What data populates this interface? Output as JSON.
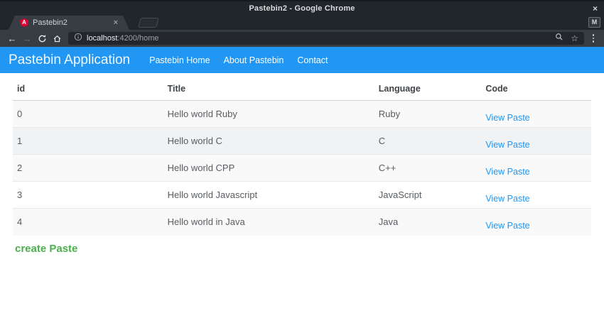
{
  "window": {
    "title": "Pastebin2 - Google Chrome",
    "close_glyph": "×"
  },
  "tabbar": {
    "favicon_letter": "A",
    "tab_title": "Pastebin2",
    "tab_close_glyph": "×",
    "profile_label": "M"
  },
  "toolbar": {
    "back_glyph": "←",
    "forward_glyph": "→",
    "url_host": "localhost",
    "url_rest": ":4200/home",
    "star_glyph": "☆"
  },
  "navbar": {
    "brand": "Pastebin Application",
    "links": [
      "Pastebin Home",
      "About Pastebin",
      "Contact"
    ]
  },
  "table": {
    "headers": [
      "id",
      "Title",
      "Language",
      "Code"
    ],
    "rows": [
      {
        "id": "0",
        "title": "Hello world Ruby",
        "language": "Ruby",
        "code_link": "View Paste"
      },
      {
        "id": "1",
        "title": "Hello world C",
        "language": "C",
        "code_link": "View Paste"
      },
      {
        "id": "2",
        "title": "Hello world CPP",
        "language": "C++",
        "code_link": "View Paste"
      },
      {
        "id": "3",
        "title": "Hello world Javascript",
        "language": "JavaScript",
        "code_link": "View Paste"
      },
      {
        "id": "4",
        "title": "Hello world in Java",
        "language": "Java",
        "code_link": "View Paste"
      }
    ]
  },
  "content": {
    "create_link": "create Paste"
  },
  "colors": {
    "accent_blue": "#2196f3",
    "link_blue": "#2196f3",
    "create_green": "#4caf50",
    "angular_red": "#dd0031",
    "chrome_dark": "#21262b",
    "chrome_toolbar": "#363c42"
  }
}
